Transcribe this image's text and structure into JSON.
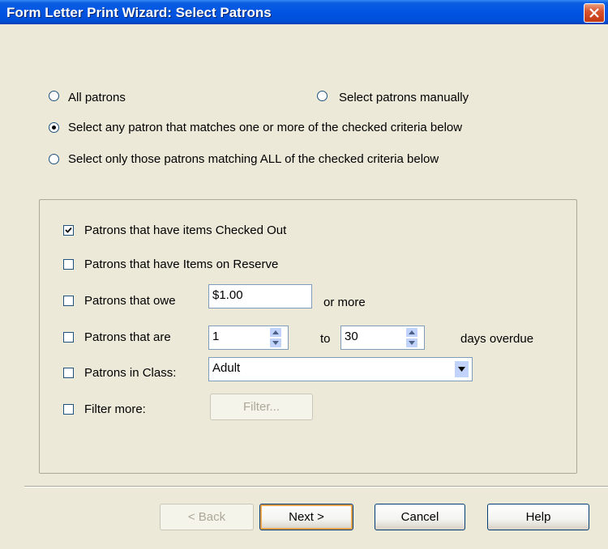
{
  "window": {
    "title": "Form Letter Print Wizard:  Select Patrons"
  },
  "selection_mode": {
    "all_patrons": "All patrons",
    "select_manually": "Select patrons manually",
    "match_any": "Select any patron that matches one or more of the checked criteria below",
    "match_all": "Select only those patrons matching ALL of the checked criteria below",
    "selected": "match_any"
  },
  "criteria": {
    "checked_out": {
      "label": "Patrons that have items Checked Out",
      "checked": true
    },
    "on_reserve": {
      "label": "Patrons that have Items on Reserve",
      "checked": false
    },
    "owe": {
      "label": "Patrons that owe",
      "checked": false,
      "amount": "$1.00",
      "suffix": "or more"
    },
    "overdue": {
      "label": "Patrons that are",
      "checked": false,
      "from": "1",
      "to_label": "to",
      "to": "30",
      "suffix": "days overdue"
    },
    "class": {
      "label": "Patrons in Class:",
      "checked": false,
      "value": "Adult"
    },
    "filter_more": {
      "label": "Filter more:",
      "checked": false,
      "button": "Filter..."
    }
  },
  "buttons": {
    "back": "< Back",
    "next": "Next >",
    "cancel": "Cancel",
    "help": "Help"
  },
  "icons": {
    "close": "close-icon",
    "checkmark": "checkmark-icon",
    "spin_up": "arrow-up-icon",
    "spin_down": "arrow-down-icon",
    "dropdown": "chevron-down-icon"
  }
}
